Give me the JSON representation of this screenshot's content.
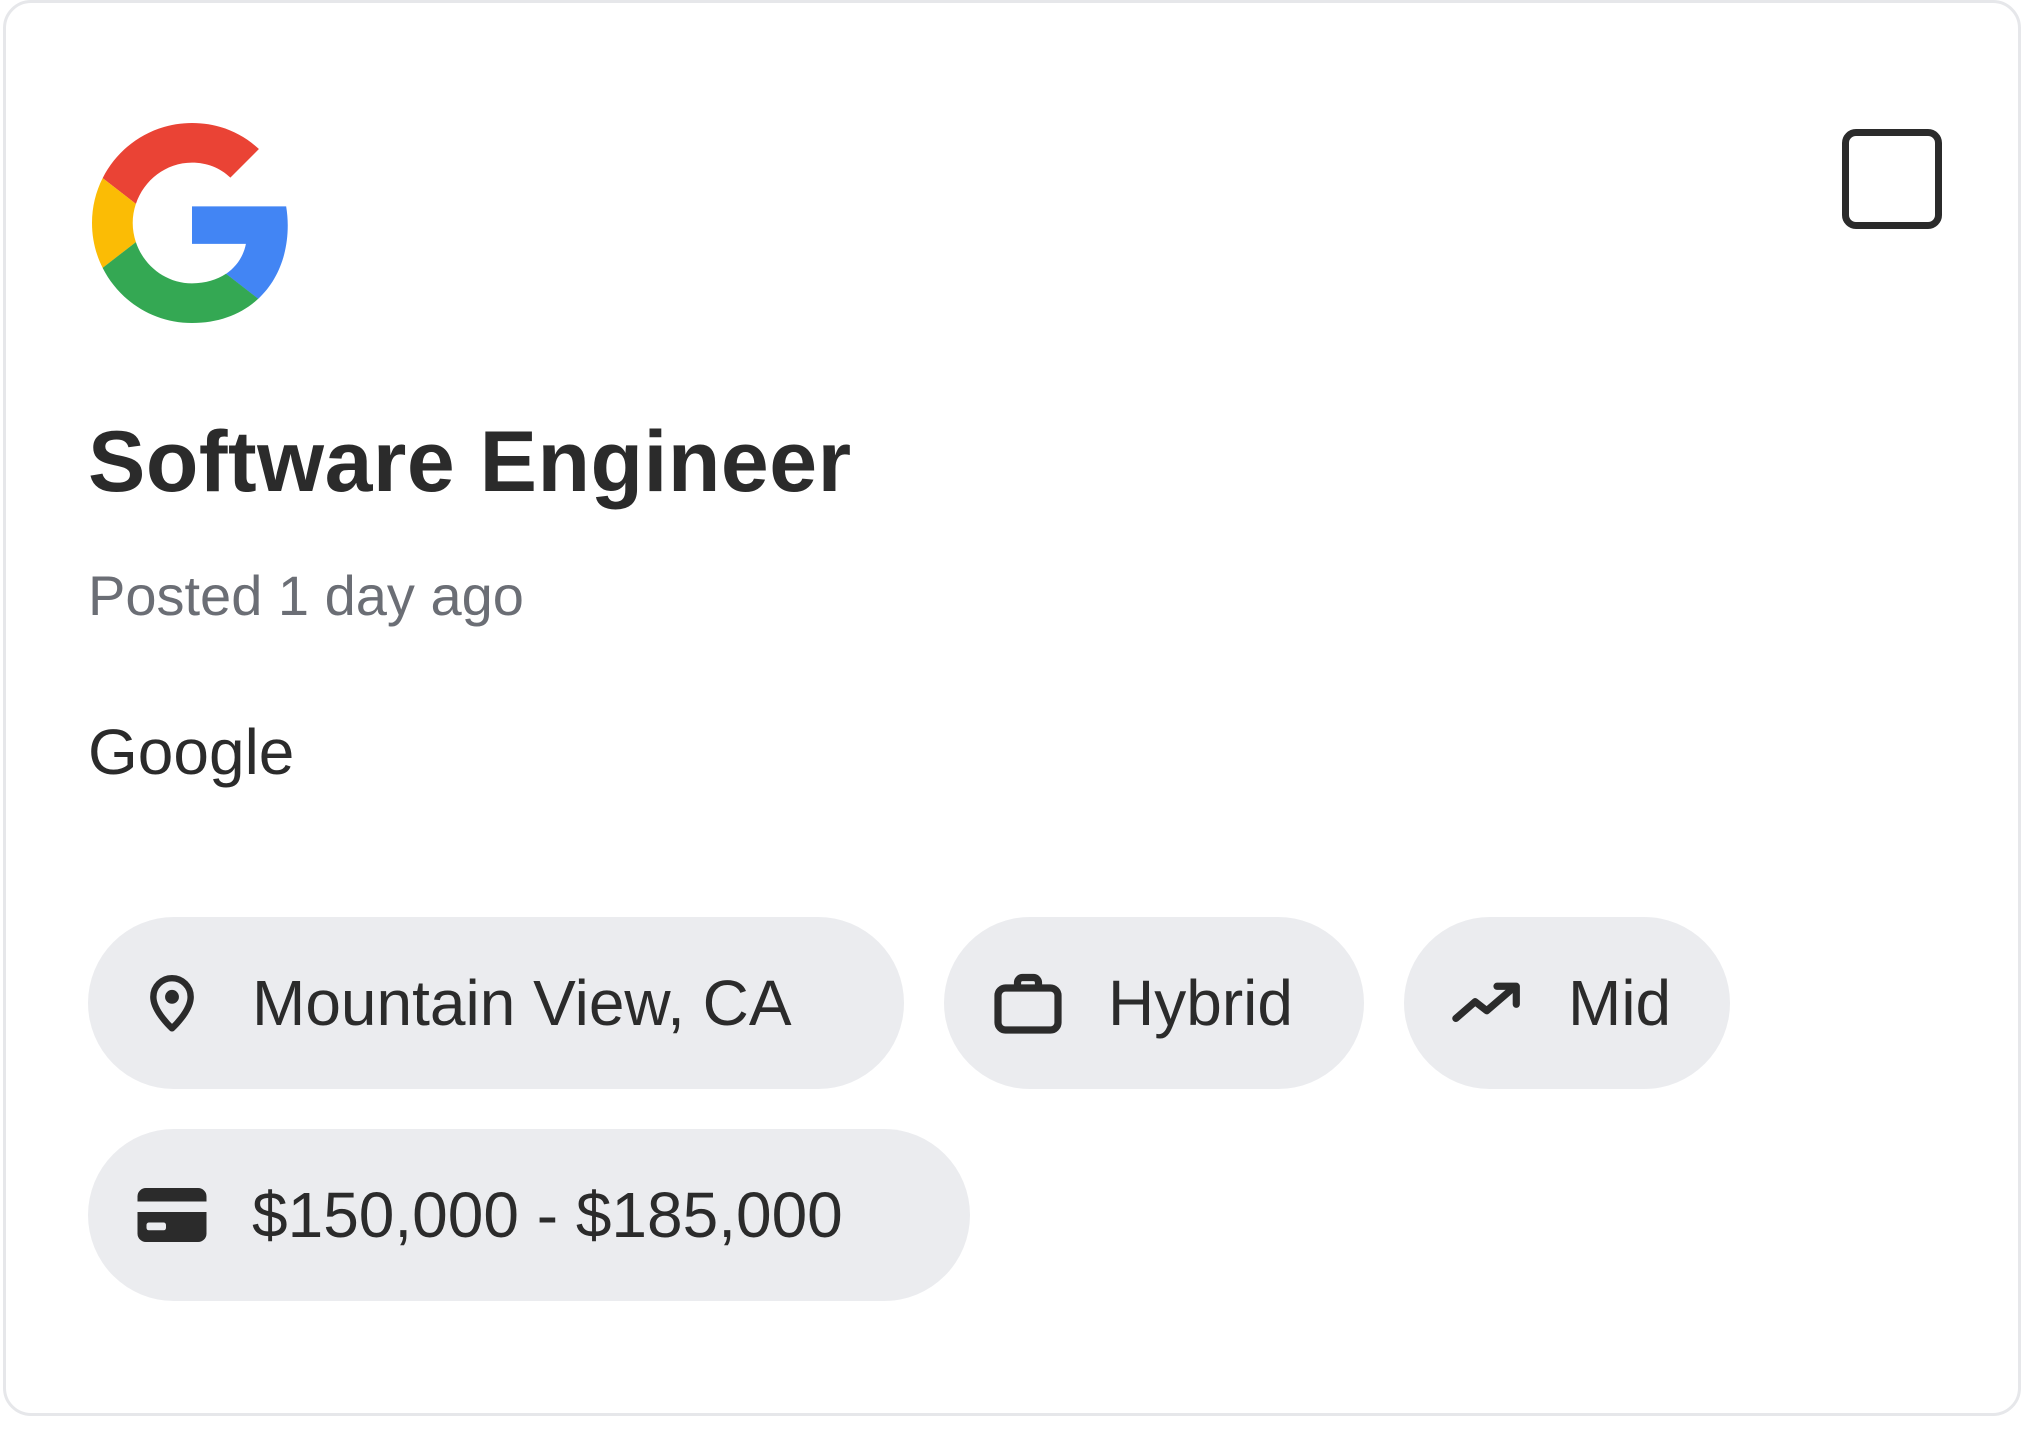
{
  "job": {
    "title": "Software Engineer",
    "posted": "Posted 1 day ago",
    "company": "Google",
    "logo_icon": "google-g-logo",
    "logo_colors": {
      "red": "#EA4335",
      "yellow": "#FBBC05",
      "green": "#34A853",
      "blue": "#4285F4"
    },
    "bookmark_checked": false
  },
  "tags": {
    "location": {
      "label": "Mountain View, CA",
      "icon": "location-pin-icon"
    },
    "workplace": {
      "label": "Hybrid",
      "icon": "briefcase-icon"
    },
    "level": {
      "label": "Mid",
      "icon": "trending-up-icon"
    },
    "salary": {
      "label": "$150,000 - $185,000",
      "icon": "credit-card-icon"
    }
  },
  "colors": {
    "text_primary": "#2B2B2B",
    "text_secondary": "#6B6E75",
    "chip_background": "#EBECEF",
    "card_border": "#E6E7EA"
  }
}
